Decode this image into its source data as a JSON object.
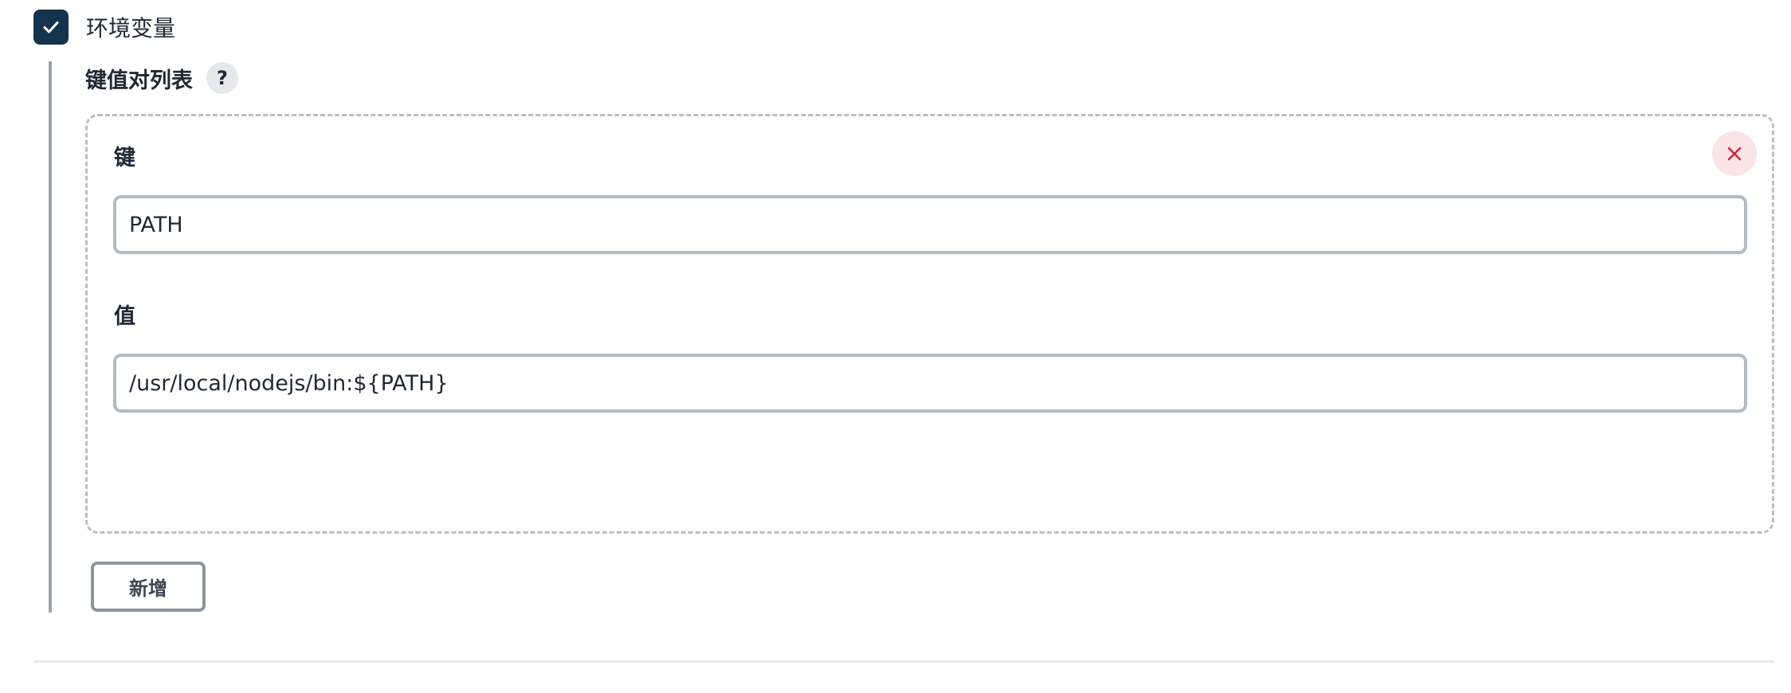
{
  "env_section": {
    "checkbox_checked": true,
    "checkbox_label": "环境变量"
  },
  "kv_list": {
    "title": "键值对列表",
    "help_label": "?",
    "items": [
      {
        "key_label": "键",
        "key_value": "PATH",
        "value_label": "值",
        "value_value": "/usr/local/nodejs/bin:${PATH}"
      }
    ],
    "add_button_label": "新增"
  },
  "colors": {
    "checkbox_fill": "#14334d",
    "delete_icon": "#d0243a",
    "delete_bg": "#fbe4e6",
    "input_border": "#b3bcc2"
  },
  "icons": {
    "checkbox": "check-icon",
    "delete": "close-icon"
  }
}
